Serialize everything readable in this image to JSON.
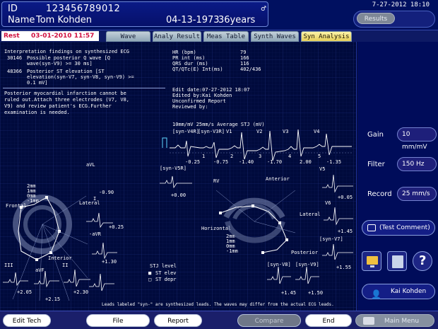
{
  "patient": {
    "id_label": "ID",
    "id_value": "123456789012",
    "name_label": "Name",
    "name_value": "Tom Kohden",
    "dob": "04-13-1973",
    "age": "36years",
    "sex_icon": "male-icon"
  },
  "header": {
    "datetime": "7-27-2012 18:10",
    "results_label": "Results"
  },
  "tabs": {
    "rest_label": "Rest",
    "rest_date": "03-01-2010 11:57",
    "items": [
      "Wave",
      "Analy Result",
      "Meas Table",
      "Synth Waves",
      "Syn Analysis"
    ],
    "active": "Syn Analysis"
  },
  "findings": {
    "header": "Interpretation findings on synthesized ECG",
    "code1": "30146",
    "text1a": "Possible posterior Q wave [Q",
    "text1b": "wave(syn-V9) >= 30 ms]",
    "code2": "48366",
    "text2a": "Posterior ST elevation [ST",
    "text2b": "elevation(syn-V7, syn-V8, syn-V9) >=",
    "text2c": "0.1 mV]",
    "comment1": "Posterior myocardial infarction cannot be",
    "comment2": "ruled out.Attach three electrodes (V7, V8,",
    "comment3": "V9) and review patient's ECG.Further",
    "comment4": "examination is needed."
  },
  "measurements": {
    "hr_label": "HR (bpm)",
    "hr_value": "79",
    "pr_label": "PR int (ms)",
    "pr_value": "166",
    "qrs_label": "QRS dur (ms)",
    "qrs_value": "116",
    "qt_label": "QT/QTc(E) Int(ms)",
    "qt_value": "402/436",
    "edit_date": "Edit date:07-27-2012 18:07",
    "edited_by": "Edited by:Kai Kohden",
    "unconfirmed": "Unconfirmed Report",
    "reviewed_by": "Reviewed by:"
  },
  "stj": {
    "header": "10mm/mV 25mm/s Average STJ (mV)",
    "leads": [
      "[syn-V4R]",
      "[syn-V3R]",
      "V1",
      "V2",
      "V3",
      "V4"
    ],
    "values": [
      "-0.25",
      "-0.75",
      "-1.40",
      "-1.70",
      "2.00",
      "-1.35"
    ],
    "symbols": [
      "1",
      "2",
      "3",
      "4",
      "5"
    ]
  },
  "frontal": {
    "title": "Frontal",
    "lateral": "Lateral",
    "interior": "Interior",
    "scale": [
      "2mm",
      "1mm",
      "0mm",
      "-1mm"
    ],
    "leads": [
      {
        "name": "aVL",
        "value": "-0.90"
      },
      {
        "name": "I",
        "value": "+0.25"
      },
      {
        "name": "-aVR",
        "value": "+1.30"
      },
      {
        "name": "III",
        "value": "+2.05"
      },
      {
        "name": "aVF",
        "value": "+2.15"
      },
      {
        "name": "II",
        "value": "+2.30"
      }
    ]
  },
  "horizontal": {
    "title": "Horizontal",
    "anterior": "Anterior",
    "lateral": "Lateral",
    "posterior": "Posterior",
    "rv": "RV",
    "scale": [
      "2mm",
      "1mm",
      "0mm",
      "-1mm"
    ],
    "leads": [
      {
        "name": "[syn-V5R]",
        "value": "+0.00"
      },
      {
        "name": "V5",
        "value": "+0.05"
      },
      {
        "name": "V6",
        "value": "+1.45"
      },
      {
        "name": "[syn-V7]",
        "value": "+1.55"
      },
      {
        "name": "[syn-V8]",
        "value": "+1.45"
      },
      {
        "name": "[syn-V9]",
        "value": "+1.50"
      }
    ]
  },
  "legend": {
    "title": "STJ level",
    "elev": "ST elev",
    "depr": "ST depr"
  },
  "footnote": "Leads labeled \"syn-\" are synthesized leads. The waves may differ from the actual ECG leads.",
  "controls": {
    "gain_label": "Gain",
    "gain_value": "10 mm/mV",
    "filter_label": "Filter",
    "filter_value": "150 Hz",
    "record_label": "Record",
    "record_value": "25 mm/s",
    "test_comment": "(Test Comment)",
    "user": "Kai Kohden",
    "help_icon": "?"
  },
  "footer": {
    "edit_tech": "Edit Tech",
    "file": "File",
    "report": "Report",
    "compare": "Compare",
    "end": "End",
    "main_menu": "Main Menu"
  },
  "colors": {
    "background": "#000a3c",
    "active_tab": "#f3dd75",
    "rest_text": "#d0103d",
    "grid": "#1c2c78"
  }
}
